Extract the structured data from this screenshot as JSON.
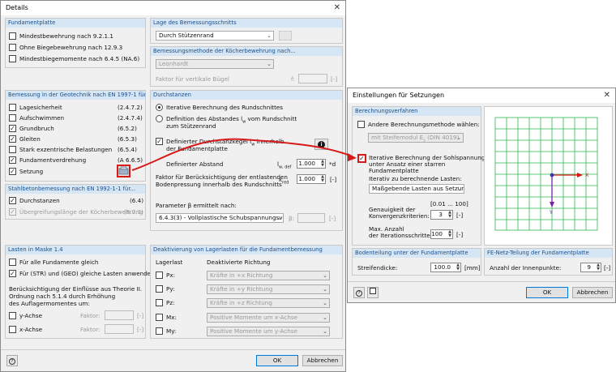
{
  "details": {
    "title": "Details",
    "close": "✕",
    "fund": {
      "header": "Fundamentplatte",
      "items": [
        "Mindestbewehrung nach 9.2.1.1",
        "Ohne Biegebewehrung nach 12.9.3",
        "Mindestbiegemomente nach 6.4.5 (NA.6)"
      ]
    },
    "lage": {
      "header": "Lage des Bemessungsschnitts",
      "value": "Durch Stützenrand"
    },
    "koecher": {
      "header": "Bemessungsmethode der Köcherbewehrung nach...",
      "value": "Leonhardt",
      "faktor_label": "Faktor für vertikale Bügel",
      "f_label": "f:",
      "unit": "[-]"
    },
    "geo": {
      "header": "Bemessung in der Geotechnik nach EN 1997-1 für...",
      "items": [
        {
          "label": "Lagesicherheit",
          "ref": "(2.4.7.2)",
          "checked": false
        },
        {
          "label": "Aufschwimmen",
          "ref": "(2.4.7.4)",
          "checked": false
        },
        {
          "label": "Grundbruch",
          "ref": "(6.5.2)",
          "checked": true
        },
        {
          "label": "Gleiten",
          "ref": "(6.5.3)",
          "checked": true
        },
        {
          "label": "Stark exzentrische Belastungen",
          "ref": "(6.5.4)",
          "checked": false
        },
        {
          "label": "Fundamentverdrehung",
          "ref": "(A 6.6.5)",
          "checked": true
        },
        {
          "label": "Setzung",
          "ref": "",
          "checked": true
        }
      ]
    },
    "durch": {
      "header": "Durchstanzen",
      "r1": "Iterative Berechnung des Rundschnittes",
      "r2a": "Definition des Abstandes l",
      "r2sub": "w",
      "r2b": " vom Rundschnitt",
      "r2c": "zum Stützenrand",
      "c1a": "Definierter Durchstanzkegel l",
      "c1sub": "w",
      "c1b": " innerhalb",
      "c1c": "der Fundamentplatte",
      "abstand_label": "Definierter Abstand",
      "abstand_sym": "l",
      "abstand_sub": "w, def",
      "abstand_val": "1.000",
      "abstand_unit": "*d",
      "faktor1": "Faktor für Berücksichtigung der entlastenden",
      "faktor2": "Bodenpressung innerhalb des Rundschnitts",
      "kred": "k",
      "kred_sub": "red",
      "kred_val": "1.000",
      "kred_unit": "[-]",
      "param_label": "Parameter β ermittelt nach:",
      "param_val": "6.4.3(3) - Vollplastische Schubspannungsverte",
      "beta_label": "β:",
      "beta_unit": "[-]",
      "info": "i"
    },
    "stahl": {
      "header": "Stahlbetonbemessung nach EN 1992-1-1 für...",
      "items": [
        {
          "label": "Durchstanzen",
          "ref": "(6.4)"
        },
        {
          "label": "Übergreifungslänge der Köcherbewehrung",
          "ref": "(8.7.3)"
        }
      ]
    },
    "lasten": {
      "header": "Lasten in Maske 1.4",
      "items": [
        "Für alle Fundamente gleich",
        "Für (STR) und (GEO) gleiche Lasten anwenden"
      ],
      "info1": "Berücksichtigung der Einflüsse aus Theorie II.",
      "info2": "Ordnung nach 5.1.4 durch Erhöhung",
      "info3": "des Auflagermomentes um:",
      "yachse": "y-Achse",
      "xachse": "x-Achse",
      "faktor": "Faktor:",
      "unit": "[-]"
    },
    "deakt": {
      "header": "Deaktivierung von Lagerlasten für die Fundamentbemessung",
      "col1": "Lagerlast",
      "col2": "Deaktivierte Richtung",
      "rows": [
        {
          "label": "Px:",
          "value": "Kräfte in +x Richtung"
        },
        {
          "label": "Py:",
          "value": "Kräfte in +y Richtung"
        },
        {
          "label": "Pz:",
          "value": "Kräfte in +z Richtung"
        },
        {
          "label": "Mx:",
          "value": "Positive Momente um x-Achse"
        },
        {
          "label": "My:",
          "value": "Positive Momente um y-Achse"
        }
      ]
    },
    "ok": "OK",
    "cancel": "Abbrechen"
  },
  "setz": {
    "title": "Einstellungen für Setzungen",
    "close": "✕",
    "verf": {
      "header": "Berechnungsverfahren",
      "andere": "Andere Berechnungsmethode wählen:",
      "methode": "mit Steifemodul E",
      "methode_sub": "s",
      "methode_b": " (DIN 4019)",
      "iter1": "Iterative Berechnung der Sohlspannung",
      "iter2": "unter Ansatz einer starren",
      "iter3": "Fundamentplatte",
      "lasten_label": "Iterativ zu berechnende Lasten:",
      "lasten_val": "Maßgebende Lasten aus Setzung",
      "range": "[0.01 ... 100]",
      "gen1": "Genauigkeit der",
      "gen2": "Konvergenzkriterien:",
      "gen_val": "3",
      "max1": "Max. Anzahl",
      "max2": "der Iterationsschritte:",
      "max_val": "100",
      "unit": "[-]"
    },
    "axis_x": "X",
    "axis_y": "Y",
    "boden": {
      "header": "Bodenteilung unter der Fundamentplatte",
      "label": "Streifendicke:",
      "value": "100.0",
      "unit": "[mm]"
    },
    "fe": {
      "header": "FE-Netz-Teilung der Fundamentplatte",
      "label": "Anzahl der Innenpunkte:",
      "value": "9",
      "unit": "[-]"
    },
    "ok": "OK",
    "cancel": "Abbrechen"
  },
  "colors": {
    "accent": "#d61a1a",
    "grid": "#2db84d",
    "header_bg": "#d6e6f5",
    "header_text": "#1c4f8a",
    "y_axis": "#7a1fa2"
  }
}
